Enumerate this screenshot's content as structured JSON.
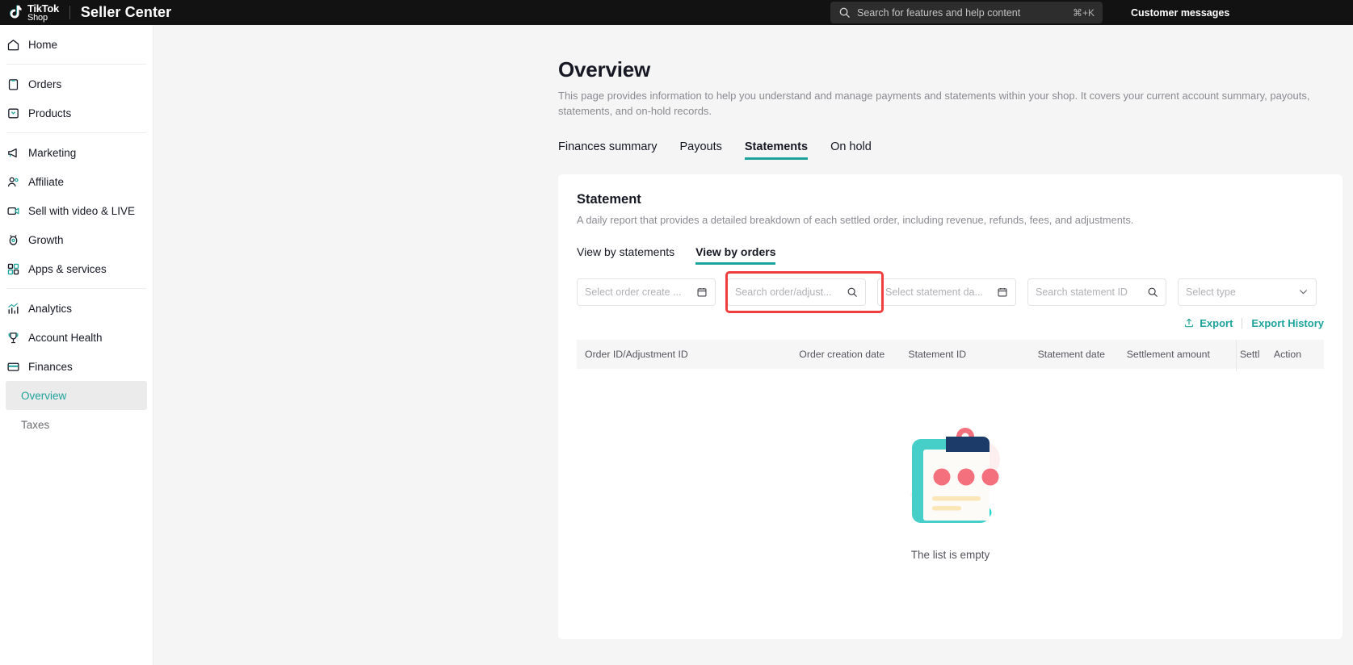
{
  "topbar": {
    "logo_line1": "TikTok",
    "logo_line2": "Shop",
    "product": "Seller Center",
    "search_placeholder": "Search for features and help content",
    "search_shortcut": "⌘+K",
    "customer_messages": "Customer messages"
  },
  "sidebar": {
    "groups": [
      {
        "items": [
          {
            "label": "Home",
            "icon": "home-icon"
          }
        ]
      },
      {
        "items": [
          {
            "label": "Orders",
            "icon": "clipboard-icon"
          },
          {
            "label": "Products",
            "icon": "box-icon"
          }
        ]
      },
      {
        "items": [
          {
            "label": "Marketing",
            "icon": "megaphone-icon"
          },
          {
            "label": "Affiliate",
            "icon": "people-icon"
          },
          {
            "label": "Sell with video & LIVE",
            "icon": "video-icon"
          },
          {
            "label": "Growth",
            "icon": "rocket-icon"
          },
          {
            "label": "Apps & services",
            "icon": "grid-apps-icon"
          }
        ]
      },
      {
        "items": [
          {
            "label": "Analytics",
            "icon": "bar-chart-icon"
          },
          {
            "label": "Account Health",
            "icon": "trophy-icon"
          },
          {
            "label": "Finances",
            "icon": "card-icon"
          }
        ]
      }
    ],
    "sub_items": [
      {
        "label": "Overview",
        "active": true
      },
      {
        "label": "Taxes",
        "active": false
      }
    ]
  },
  "page": {
    "title": "Overview",
    "description": "This page provides information to help you understand and manage payments and statements within your shop. It covers your current account summary, payouts, statements, and on-hold records."
  },
  "tabs": [
    {
      "label": "Finances summary",
      "active": false
    },
    {
      "label": "Payouts",
      "active": false
    },
    {
      "label": "Statements",
      "active": true
    },
    {
      "label": "On hold",
      "active": false
    }
  ],
  "statement_card": {
    "heading": "Statement",
    "description": "A daily report that provides a detailed breakdown of each settled order, including revenue, refunds, fees, and adjustments.",
    "subtabs": [
      {
        "label": "View by statements",
        "active": false
      },
      {
        "label": "View by orders",
        "active": true
      }
    ],
    "filters": {
      "order_create_date": {
        "placeholder": "Select order create ...",
        "value": "",
        "icon": "calendar-icon"
      },
      "order_search": {
        "placeholder": "Search order/adjust...",
        "value": "",
        "icon": "search-icon",
        "highlighted": true
      },
      "statement_date": {
        "placeholder": "Select statement da...",
        "value": "",
        "icon": "calendar-icon"
      },
      "statement_id": {
        "placeholder": "Search statement ID",
        "value": "",
        "icon": "search-icon"
      },
      "type": {
        "placeholder": "Select type",
        "value": "",
        "icon": "chevron-down-icon"
      }
    },
    "export_label": "Export",
    "export_history_label": "Export History",
    "table": {
      "columns": [
        "Order ID/Adjustment ID",
        "Order creation date",
        "Statement ID",
        "Statement date",
        "Settlement amount",
        "Settl",
        "Action"
      ],
      "rows": [],
      "empty_text": "The list is empty"
    }
  },
  "colors": {
    "accent_teal": "#1ea39c",
    "highlight_red": "#f03e3e",
    "topbar_bg": "#121212"
  }
}
